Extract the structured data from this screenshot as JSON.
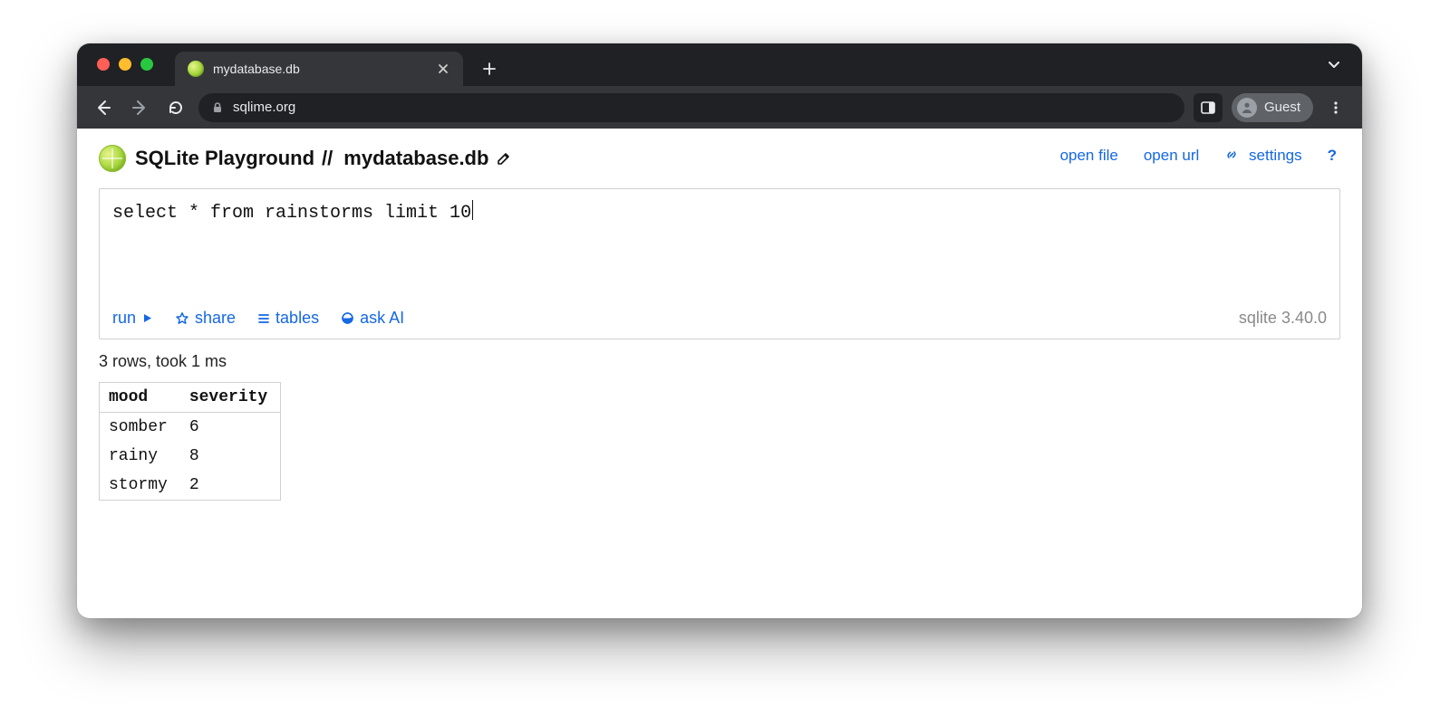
{
  "browser": {
    "tab_title": "mydatabase.db",
    "url_display": "sqlime.org",
    "profile_label": "Guest"
  },
  "app": {
    "title": "SQLite Playground",
    "separator": "//",
    "db_name": "mydatabase.db",
    "links": {
      "open_file": "open file",
      "open_url": "open url",
      "settings": "settings",
      "help": "?"
    }
  },
  "editor": {
    "sql": "select * from rainstorms limit 10",
    "actions": {
      "run": "run",
      "share": "share",
      "tables": "tables",
      "ask_ai": "ask AI"
    },
    "engine_version": "sqlite 3.40.0"
  },
  "result": {
    "status": "3 rows, took 1 ms",
    "columns": [
      "mood",
      "severity"
    ],
    "rows": [
      {
        "mood": "somber",
        "severity": "6"
      },
      {
        "mood": "rainy",
        "severity": "8"
      },
      {
        "mood": "stormy",
        "severity": "2"
      }
    ]
  }
}
